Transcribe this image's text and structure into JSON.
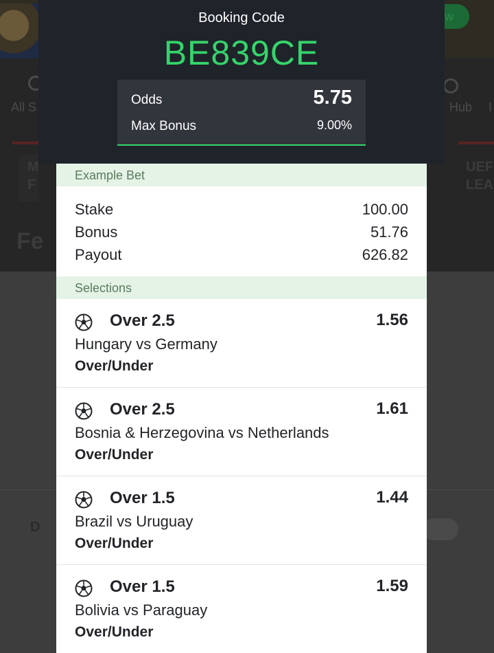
{
  "background": {
    "nav": [
      "All S",
      "Hub",
      "I"
    ],
    "tabs_left": [
      "M",
      "F"
    ],
    "tabs_right": [
      "UEF",
      "LEA"
    ],
    "section_title": "Fe",
    "row_label": "D"
  },
  "booking": {
    "title": "Booking Code",
    "code": "BE839CE",
    "odds_label": "Odds",
    "odds_value": "5.75",
    "max_bonus_label": "Max Bonus",
    "max_bonus_value": "9.00%"
  },
  "example_bet": {
    "header": "Example Bet",
    "rows": [
      {
        "label": "Stake",
        "value": "100.00"
      },
      {
        "label": "Bonus",
        "value": "51.76"
      },
      {
        "label": "Payout",
        "value": "626.82"
      }
    ]
  },
  "selections": {
    "header": "Selections",
    "items": [
      {
        "icon": "soccer-ball-icon",
        "market": "Over 2.5",
        "odds": "1.56",
        "match": "Hungary vs Germany",
        "type": "Over/Under"
      },
      {
        "icon": "soccer-ball-icon",
        "market": "Over 2.5",
        "odds": "1.61",
        "match": "Bosnia & Herzegovina vs Netherlands",
        "type": "Over/Under"
      },
      {
        "icon": "soccer-ball-icon",
        "market": "Over 1.5",
        "odds": "1.44",
        "match": "Brazil vs Uruguay",
        "type": "Over/Under"
      },
      {
        "icon": "soccer-ball-icon",
        "market": "Over 1.5",
        "odds": "1.59",
        "match": "Bolivia vs Paraguay",
        "type": "Over/Under"
      }
    ]
  },
  "colors": {
    "accent": "#35d46b",
    "panel": "#1f232a",
    "section_bg": "#e4f3e6"
  }
}
